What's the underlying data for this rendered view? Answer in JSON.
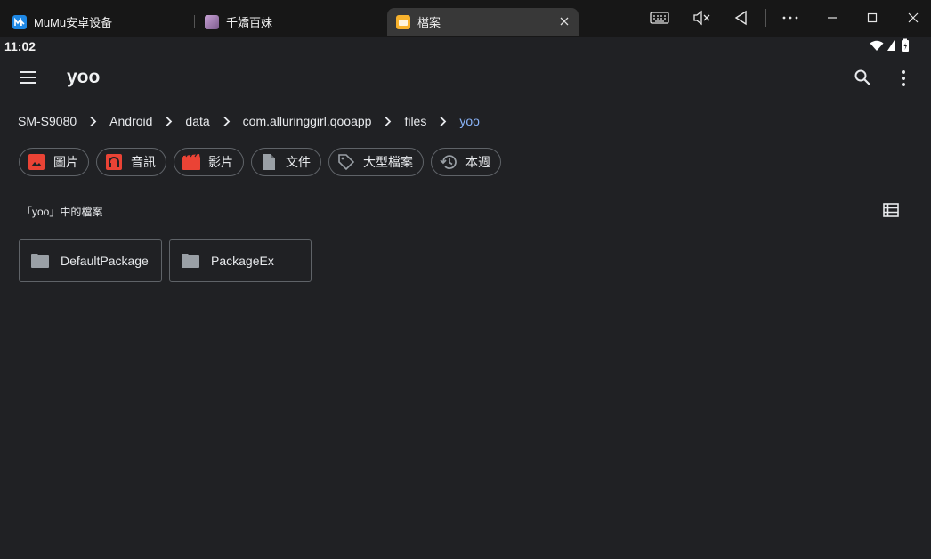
{
  "window": {
    "tabs": [
      {
        "label": "MuMu安卓设备",
        "icon": "mumu-logo-icon"
      },
      {
        "label": "千嬌百妹",
        "icon": "game-avatar-icon"
      },
      {
        "label": "檔案",
        "icon": "files-app-icon",
        "active": true
      }
    ],
    "controls": [
      "keyboard-icon",
      "mute-icon",
      "back-triangle-icon",
      "more-horizontal-icon",
      "minimize-icon",
      "maximize-icon",
      "close-icon"
    ]
  },
  "status": {
    "time": "11:02"
  },
  "appbar": {
    "title": "yoo"
  },
  "breadcrumb": [
    "SM-S9080",
    "Android",
    "data",
    "com.alluringgirl.qooapp",
    "files",
    "yoo"
  ],
  "chips": [
    {
      "label": "圖片",
      "icon": "image-icon",
      "color": "#ea4335"
    },
    {
      "label": "音訊",
      "icon": "headphones-icon",
      "color": "#ea4335"
    },
    {
      "label": "影片",
      "icon": "movie-icon",
      "color": "#ea4335"
    },
    {
      "label": "文件",
      "icon": "document-icon",
      "color": "#9aa0a6"
    },
    {
      "label": "大型檔案",
      "icon": "tag-icon",
      "color": "#9aa0a6"
    },
    {
      "label": "本週",
      "icon": "history-icon",
      "color": "#9aa0a6"
    }
  ],
  "section": {
    "title": "「yoo」中的檔案"
  },
  "folders": [
    {
      "name": "DefaultPackage"
    },
    {
      "name": "PackageEx"
    }
  ]
}
